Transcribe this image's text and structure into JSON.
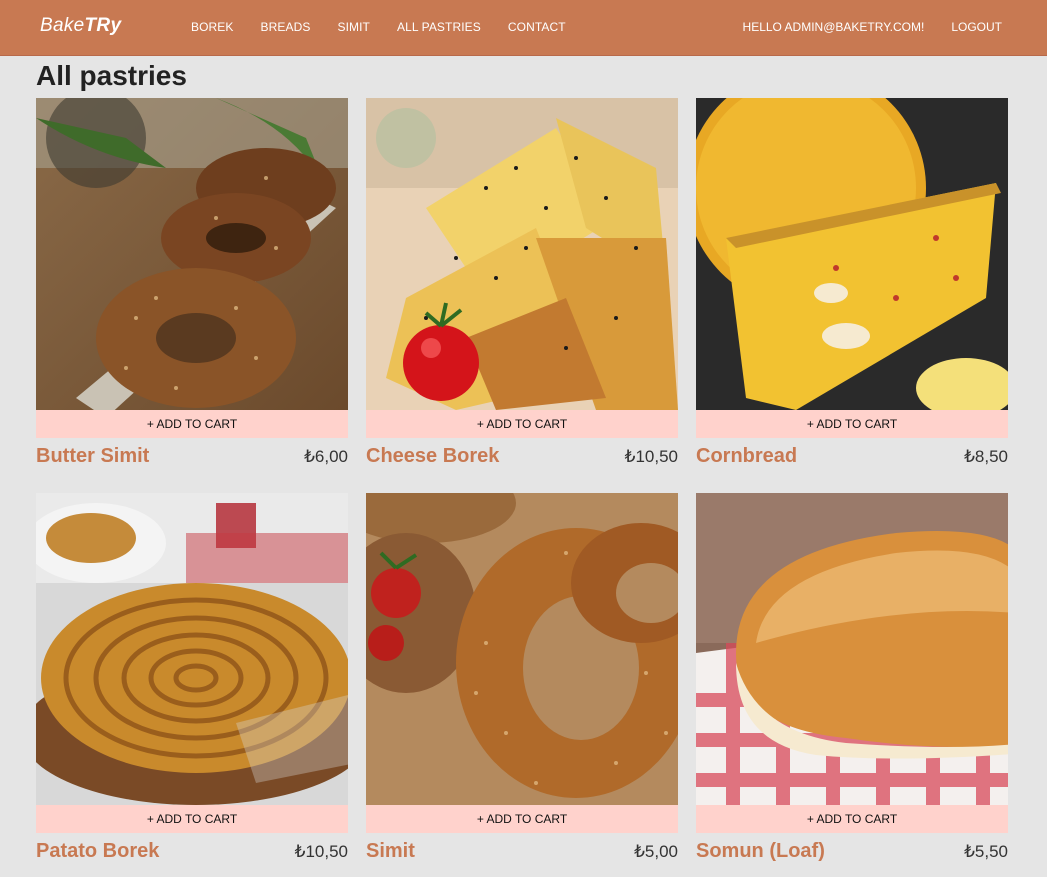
{
  "brand": {
    "light": "Bake",
    "bold": "TRy"
  },
  "nav": {
    "links": [
      "BOREK",
      "BREADS",
      "SIMIT",
      "ALL PASTRIES",
      "CONTACT"
    ],
    "greeting": "HELLO ADMIN@BAKETRY.COM!",
    "logout": "LOGOUT"
  },
  "page_title": "All pastries",
  "colors": {
    "navbar": "#c87952",
    "accent": "#c87952",
    "button_bg": "#ffd2cc",
    "page_bg": "#e5e5e5"
  },
  "products": [
    {
      "name": "Butter Simit",
      "price": "₺6,00",
      "button": "+ ADD TO CART",
      "image": "sesame-simit-on-plate"
    },
    {
      "name": "Cheese Borek",
      "price": "₺10,50",
      "button": "+ ADD TO CART",
      "image": "cheese-borek-with-tomato"
    },
    {
      "name": "Cornbread",
      "price": "₺8,50",
      "button": "+ ADD TO CART",
      "image": "cornbread-slice"
    },
    {
      "name": "Patato Borek",
      "price": "₺10,50",
      "button": "+ ADD TO CART",
      "image": "spiral-potato-borek"
    },
    {
      "name": "Simit",
      "price": "₺5,00",
      "button": "+ ADD TO CART",
      "image": "simit-rings-on-board"
    },
    {
      "name": "Somun (Loaf)",
      "price": "₺5,50",
      "button": "+ ADD TO CART",
      "image": "bread-loaf-on-checkered-cloth"
    }
  ]
}
